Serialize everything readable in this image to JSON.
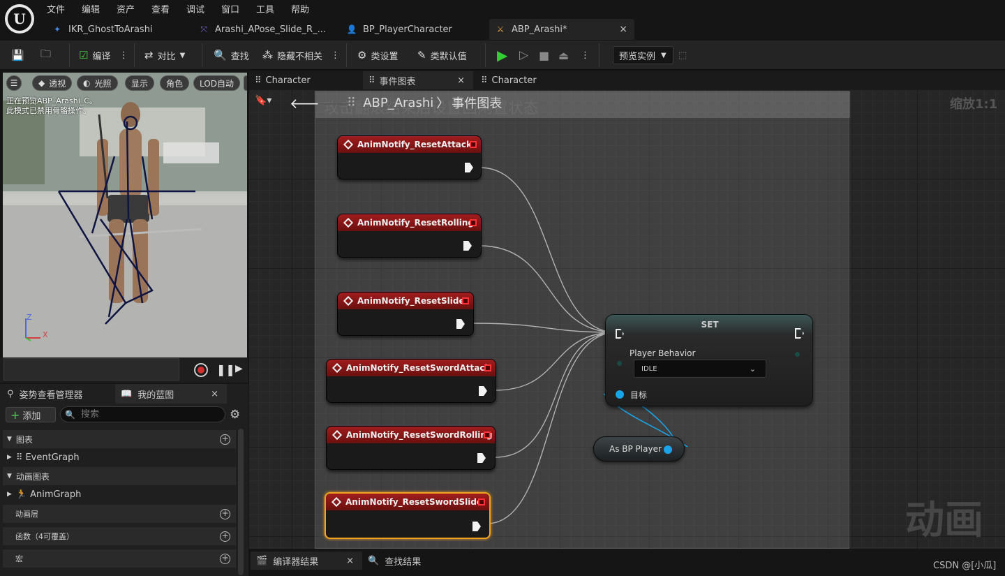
{
  "menu": [
    "文件",
    "编辑",
    "资产",
    "查看",
    "调试",
    "窗口",
    "工具",
    "帮助"
  ],
  "doc_tabs": [
    {
      "label": "IKR_GhostToArashi"
    },
    {
      "label": "Arashi_APose_Slide_R_..."
    },
    {
      "label": "BP_PlayerCharacter"
    },
    {
      "label": "ABP_Arashi*",
      "close": "×"
    }
  ],
  "toolbar": {
    "compile": "编译",
    "diff": "对比",
    "find": "查找",
    "hide_unrelated": "隐藏不相关",
    "class_settings": "类设置",
    "class_defaults": "类默认值",
    "preview_instance": "预览实例"
  },
  "viewport": {
    "buttons": [
      "透视",
      "光照",
      "显示",
      "角色",
      "LOD自动"
    ],
    "overlay_line1": "正在预览ABP_Arashi_C。",
    "overlay_line2": "此模式已禁用骨骼操作。",
    "axis_z": "Z",
    "axis_x": "X"
  },
  "left_tabs": {
    "pose": "姿势查看管理器",
    "my_blueprint": "我的蓝图",
    "close": "×"
  },
  "my_blueprint": {
    "add": "添加",
    "search_placeholder": "搜索",
    "graphs_section": "图表",
    "event_graph": "EventGraph",
    "anim_graphs_section": "动画图表",
    "anim_graph": "AnimGraph",
    "anim_layers": "动画层",
    "functions": "函数（4可覆盖）",
    "macros": "宏"
  },
  "graph_tabs": [
    {
      "label": "Character"
    },
    {
      "label": "事件图表",
      "close": "×"
    },
    {
      "label": "Character"
    }
  ],
  "graph": {
    "breadcrumb_root": "ABP_Arashi",
    "breadcrumb_sep": "〉",
    "breadcrumb_leaf": "事件图表",
    "zoom": "缩放1:1",
    "comment": "攻击翻滚结束后设置回闲置状态",
    "watermark": "动画",
    "events": [
      "AnimNotify_ResetAttack",
      "AnimNotify_ResetRolling",
      "AnimNotify_ResetSlide",
      "AnimNotify_ResetSwordAttack",
      "AnimNotify_ResetSwordRolling",
      "AnimNotify_ResetSwordSlide"
    ],
    "set_node": {
      "title": "SET",
      "var": "Player Behavior",
      "value": "IDLE",
      "target": "目标"
    },
    "cast_node": "As BP Player"
  },
  "bottom": {
    "compiler_results": "编译器结果",
    "close": "×",
    "find_results": "查找结果",
    "credit": "CSDN @[小瓜]"
  },
  "colors": {
    "event_header": "#8a1818",
    "exec_pin": "#f2f2f2",
    "object_pin": "#1aa3e8",
    "selected_outline": "#f0a020"
  }
}
